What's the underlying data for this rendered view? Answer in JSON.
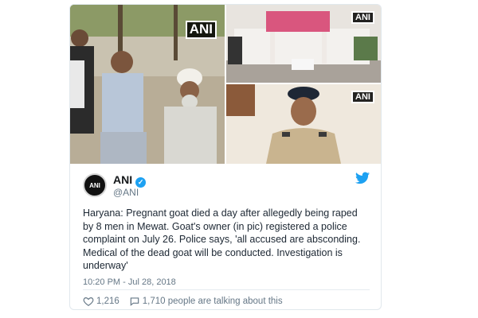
{
  "tweet": {
    "author_name": "ANI",
    "author_handle": "@ANI",
    "avatar_label": "ANI",
    "text": "Haryana: Pregnant goat died a day after allegedly being raped\nby 8 men in Mewat. Goat's owner (in pic) registered a police\ncomplaint on July 26. Police says, 'all accused are absconding.\nMedical of the dead goat will be conducted. Investigation is\nunderway'",
    "timestamp": "10:20 PM - Jul 28, 2018",
    "like_count": "1,216",
    "talking_text": "1,710 people are talking about this"
  },
  "media": {
    "watermark_main": "ANI",
    "watermark_top_right": "ANI",
    "watermark_bottom_right": "ANI"
  },
  "colors": {
    "accent": "#1da1f2",
    "text": "#1c2733",
    "muted": "#657786"
  },
  "icons": {
    "verified": "verified-badge-icon",
    "brand": "twitter-bird-icon",
    "like": "heart-icon",
    "reply": "speech-bubble-icon"
  }
}
